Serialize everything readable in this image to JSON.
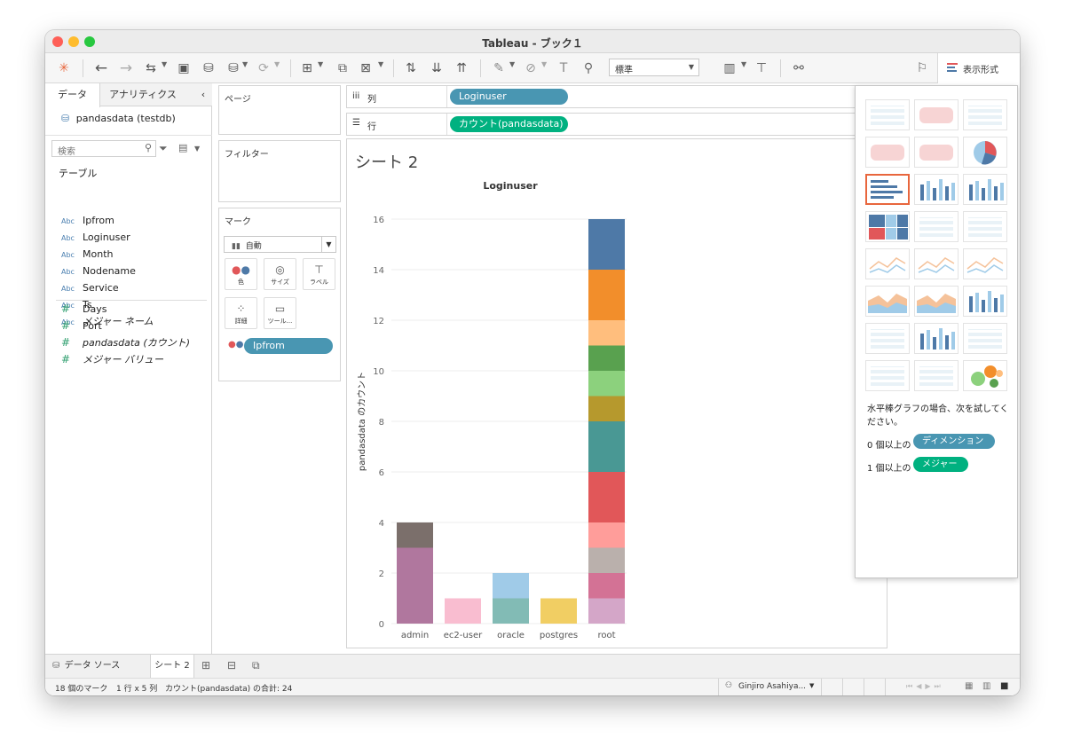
{
  "window": {
    "title": "Tableau - ブック１"
  },
  "toolbar": {
    "zoom": "標準",
    "showme_label": "表示形式"
  },
  "left": {
    "tab_data": "データ",
    "tab_analytics": "アナリティクス",
    "datasource": "pandasdata (testdb)",
    "search_placeholder": "検索",
    "tables_header": "テーブル",
    "dimensions": [
      {
        "type": "Abc",
        "name": "Ipfrom"
      },
      {
        "type": "Abc",
        "name": "Loginuser"
      },
      {
        "type": "Abc",
        "name": "Month"
      },
      {
        "type": "Abc",
        "name": "Nodename"
      },
      {
        "type": "Abc",
        "name": "Service"
      },
      {
        "type": "Abc",
        "name": "Ts"
      },
      {
        "type": "Abc",
        "name": "メジャー ネーム"
      }
    ],
    "measures": [
      {
        "type": "#",
        "name": "Days"
      },
      {
        "type": "#",
        "name": "Port"
      },
      {
        "type": "#",
        "name": "pandasdata (カウント)"
      },
      {
        "type": "#",
        "name": "メジャー バリュー"
      }
    ]
  },
  "shelves": {
    "pages": "ページ",
    "filters": "フィルター",
    "marks": "マーク",
    "mark_type": "自動",
    "mark_buttons": {
      "color": "色",
      "size": "サイズ",
      "label": "ラベル",
      "detail": "詳細",
      "tooltip": "ツール..."
    },
    "color_pill": "Ipfrom",
    "columns_label": "列",
    "rows_label": "行",
    "columns_pill": "Loginuser",
    "rows_pill": "カウント(pandasdata)"
  },
  "sheet_title": "シート 2",
  "chart_data": {
    "type": "bar",
    "stacked": true,
    "title": "Loginuser",
    "ylabel": "pandasdata のカウント",
    "xlabel": "",
    "ylim": [
      0,
      16
    ],
    "yticks": [
      0,
      2,
      4,
      6,
      8,
      10,
      12,
      14,
      16
    ],
    "grid": true,
    "categories": [
      "admin",
      "ec2-user",
      "oracle",
      "postgres",
      "root"
    ],
    "stacks": [
      [
        {
          "value": 3,
          "color": "#b0779e"
        },
        {
          "value": 1,
          "color": "#7b6f6b"
        }
      ],
      [
        {
          "value": 1,
          "color": "#f9bdd0"
        }
      ],
      [
        {
          "value": 1,
          "color": "#82bbb5"
        },
        {
          "value": 1,
          "color": "#a0cbe8"
        }
      ],
      [
        {
          "value": 1,
          "color": "#f1ce63"
        }
      ],
      [
        {
          "value": 1,
          "color": "#d4a6c8"
        },
        {
          "value": 1,
          "color": "#d37295"
        },
        {
          "value": 1,
          "color": "#bab0ac"
        },
        {
          "value": 1,
          "color": "#ff9d9a"
        },
        {
          "value": 2,
          "color": "#e15759"
        },
        {
          "value": 2,
          "color": "#499894"
        },
        {
          "value": 1,
          "color": "#b6992d"
        },
        {
          "value": 1,
          "color": "#8cd17d"
        },
        {
          "value": 1,
          "color": "#59a14f"
        },
        {
          "value": 1,
          "color": "#ffbe7d"
        },
        {
          "value": 2,
          "color": "#f28e2b"
        },
        {
          "value": 2,
          "color": "#4e79a7"
        }
      ]
    ]
  },
  "showme": {
    "hint": "水平棒グラフの場合、次を試してください。",
    "dim_prefix": "0 個以上の",
    "dim_pill": "ディメンション",
    "mea_prefix": "1 個以上の",
    "mea_pill": "メジャー"
  },
  "tabs": {
    "datasource": "データ ソース",
    "sheet": "シート 2"
  },
  "status": {
    "marks": "18 個のマーク",
    "rowscols": "1 行 x 5 列",
    "sum": "カウント(pandasdata) の合計: 24",
    "user": "Ginjiro Asahiya..."
  },
  "colors": {
    "pill_dim": "#4996b2",
    "pill_mea": "#00b180",
    "selected": "#e8663d"
  }
}
